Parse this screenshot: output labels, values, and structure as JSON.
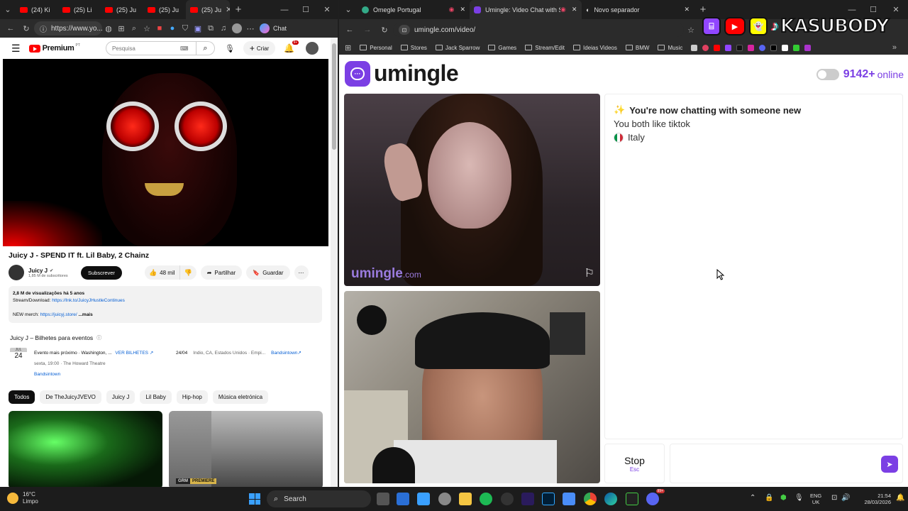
{
  "left_browser": {
    "tabs": [
      "(24) Ki",
      "(25) Li",
      "(25) Ju",
      "(25) Ju",
      "(25) Ju"
    ],
    "new_tab": "+",
    "url": "https://www.yo...",
    "chat_label": "Chat",
    "youtube": {
      "logo": "Premium",
      "logo_sup": "PT",
      "search_placeholder": "Pesquisa",
      "create_label": "Criar",
      "notif_count": "9+",
      "video_title": "Juicy J - SPEND IT ft. Lil Baby, 2 Chainz",
      "channel": "Juicy J",
      "subs": "1,85 M de subscritores",
      "subscribe": "Subscrever",
      "likes": "48 mil",
      "share": "Partilhar",
      "save": "Guardar",
      "views": "2,8 M de visualizações",
      "age": "há 5 anos",
      "stream_label": "Stream/Download:",
      "stream_link": "https://lnk.to/JuicyJHustleContinues",
      "merch_label": "NEW merch:",
      "merch_link": "https://juicyj.store/",
      "more": "...mais",
      "events_title": "Juicy J – Bilhetes para eventos",
      "event_month": "JUL",
      "event_day": "24",
      "event_name": "Evento mais próximo · Washington, ...",
      "event_time": "sexta, 19:00 · The Howard Theatre",
      "event_source": "Bandsintown",
      "tickets": "VER BILHETES",
      "event2_date": "24/04",
      "event2_place": "Indio, CA, Estados Unidos · Empi...",
      "event2_source": "Bandsintown",
      "chips": [
        "Todos",
        "De TheJuicyJVEVO",
        "Juicy J",
        "Lil Baby",
        "Hip-hop",
        "Música eletrónica"
      ],
      "thumb2_badge": "PREMIERE",
      "thumb2_brand": "GRM"
    }
  },
  "right_browser": {
    "tabs": [
      "Omegle Portugal",
      "Umingle: Video Chat with S",
      "Novo separador"
    ],
    "new_tab": "+",
    "url": "umingle.com/video/",
    "bookmarks": [
      "Personal",
      "Stores",
      "Jack Sparrow",
      "Games",
      "Stream/Edit",
      "Ideias Videos",
      "BMW",
      "Music"
    ],
    "overlay_text": "KASUBODY",
    "umingle": {
      "logo": "umingle",
      "online_count": "9142+",
      "online_label": "online",
      "watermark": "umingle",
      "watermark_suffix": ".com",
      "chat_sparkle": "✨",
      "chat_line1": "You're now chatting with someone new",
      "chat_line2": "You both like tiktok",
      "chat_country": "Italy",
      "stop_label": "Stop",
      "stop_hint": "Esc"
    }
  },
  "taskbar": {
    "weather_temp": "16°C",
    "weather_desc": "Limpo",
    "search": "Search",
    "lang1": "ENG",
    "lang2": "UK",
    "time": "21:54",
    "date": "28/03/2026",
    "badge": "99+"
  }
}
